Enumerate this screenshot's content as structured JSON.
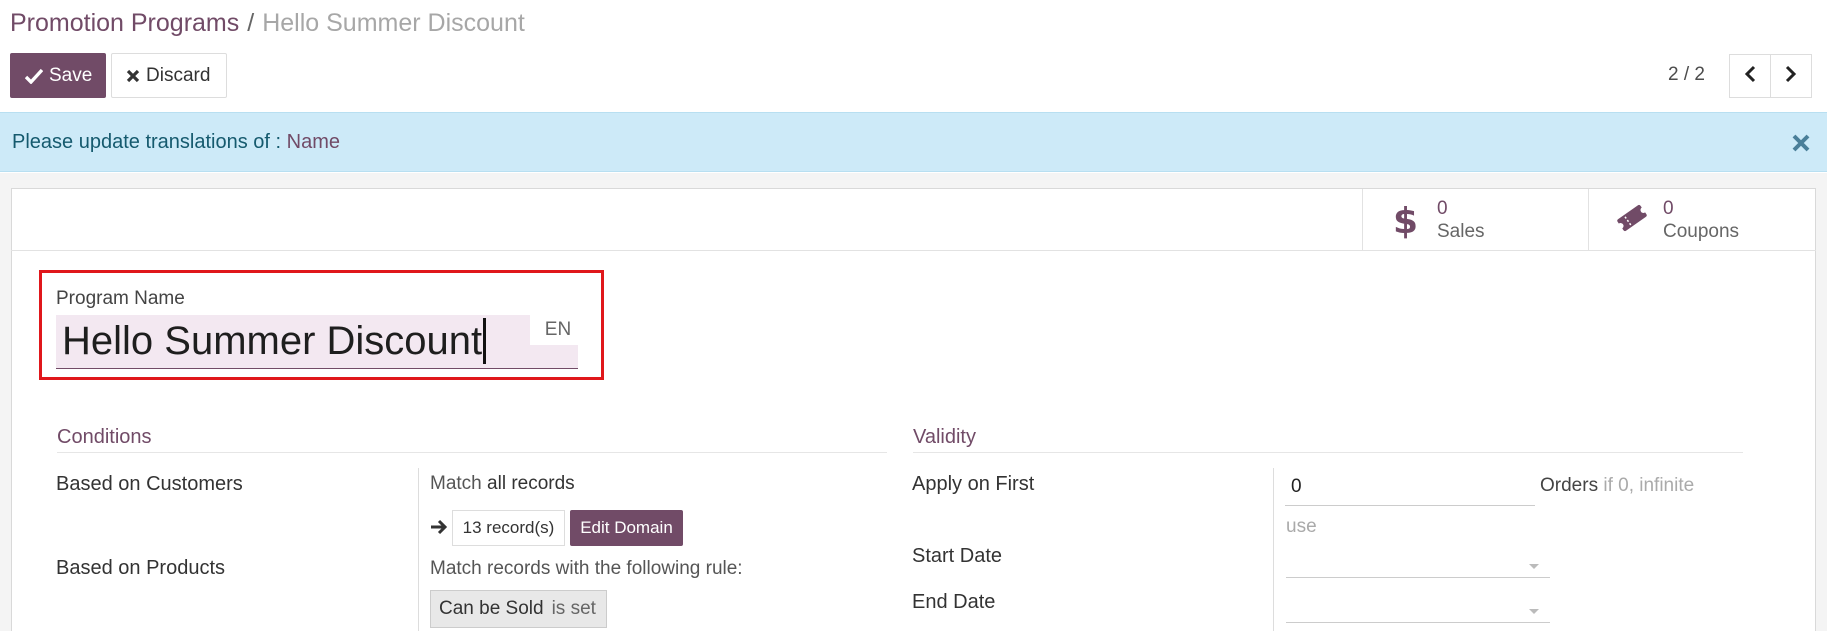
{
  "breadcrumb": {
    "root": "Promotion Programs",
    "separator": "/",
    "current": "Hello Summer Discount"
  },
  "toolbar": {
    "save_label": "Save",
    "discard_label": "Discard"
  },
  "pager": {
    "value": "2 / 2"
  },
  "alert": {
    "text": "Please update translations of :",
    "field": "Name"
  },
  "stats": {
    "sales": {
      "count": "0",
      "label": "Sales",
      "icon": "dollar-icon"
    },
    "coupons": {
      "count": "0",
      "label": "Coupons",
      "icon": "ticket-icon"
    }
  },
  "program": {
    "name_label": "Program Name",
    "name_value": "Hello Summer Discount",
    "lang_label": "EN"
  },
  "conditions": {
    "title": "Conditions",
    "customers_label": "Based on Customers",
    "match_prefix": "Match",
    "match_value": "all records",
    "records_label": "13 record(s)",
    "edit_domain_label": "Edit Domain",
    "products_label": "Based on Products",
    "products_rule_text": "Match records with the following rule:",
    "rule_field": "Can be Sold",
    "rule_operator": "is set"
  },
  "validity": {
    "title": "Validity",
    "apply_label": "Apply on First",
    "apply_value": "0",
    "apply_unit": "Orders",
    "apply_help": "if 0, infinite",
    "apply_help_cont": "use",
    "start_label": "Start Date",
    "end_label": "End Date"
  },
  "colors": {
    "brand": "#714b67",
    "alert_bg": "#cdeaf8",
    "highlight": "#e0171b"
  }
}
